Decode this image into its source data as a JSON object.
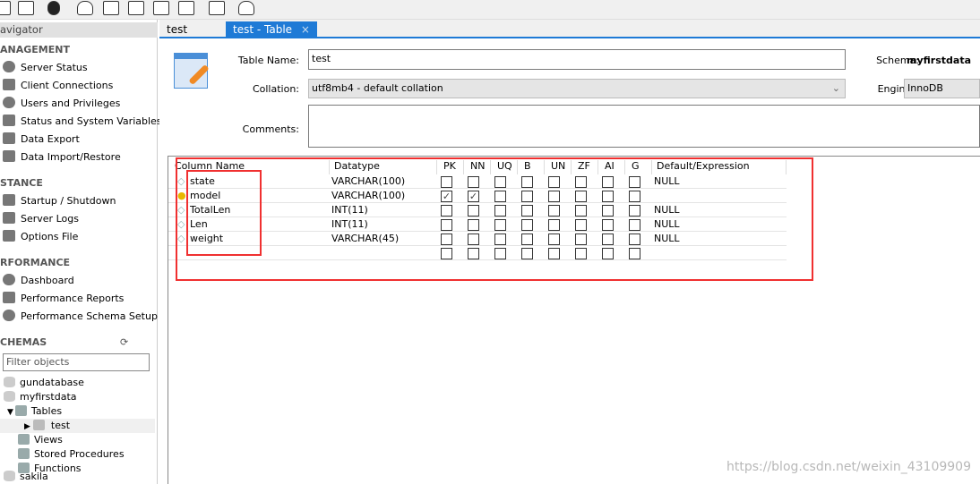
{
  "toolbar": {
    "icons": [
      "new-connection-icon",
      "open-sql-icon",
      "info-icon",
      "create-schema-icon",
      "create-table-icon",
      "create-view-icon",
      "create-procedure-icon",
      "create-function-icon",
      "search-table-icon",
      "reconnect-icon"
    ]
  },
  "sidebar": {
    "header": "avigator",
    "management": {
      "title": "ANAGEMENT",
      "items": [
        "Server Status",
        "Client Connections",
        "Users and Privileges",
        "Status and System Variables",
        "Data Export",
        "Data Import/Restore"
      ]
    },
    "instance": {
      "title": "STANCE",
      "items": [
        "Startup / Shutdown",
        "Server Logs",
        "Options File"
      ]
    },
    "performance": {
      "title": "RFORMANCE",
      "items": [
        "Dashboard",
        "Performance Reports",
        "Performance Schema Setup"
      ]
    },
    "schemas": {
      "title": "CHEMAS",
      "filter_placeholder": "Filter objects",
      "tree": [
        "gundatabase",
        "myfirstdata",
        "Tables",
        "test",
        "Views",
        "Stored Procedures",
        "Functions",
        "sakila"
      ]
    }
  },
  "tabs": [
    {
      "label": "test"
    },
    {
      "label": "test - Table",
      "close": "×",
      "active": true
    }
  ],
  "form": {
    "table_name_label": "Table Name:",
    "table_name": "test",
    "schema_label": "Schema:",
    "schema": "myfirstdata",
    "collation_label": "Collation:",
    "collation": "utf8mb4 - default collation",
    "engine_label": "Engine:",
    "engine": "InnoDB",
    "comments_label": "Comments:",
    "comments": ""
  },
  "grid": {
    "headers": [
      "Column Name",
      "Datatype",
      "PK",
      "NN",
      "UQ",
      "B",
      "UN",
      "ZF",
      "AI",
      "G",
      "Default/Expression"
    ],
    "rows": [
      {
        "name": "state",
        "type": "VARCHAR(100)",
        "flags": [
          false,
          false,
          false,
          false,
          false,
          false,
          false,
          false
        ],
        "default": "NULL",
        "key": false
      },
      {
        "name": "model",
        "type": "VARCHAR(100)",
        "flags": [
          true,
          true,
          false,
          false,
          false,
          false,
          false,
          false
        ],
        "default": "",
        "key": true
      },
      {
        "name": "TotalLen",
        "type": "INT(11)",
        "flags": [
          false,
          false,
          false,
          false,
          false,
          false,
          false,
          false
        ],
        "default": "NULL",
        "key": false
      },
      {
        "name": "Len",
        "type": "INT(11)",
        "flags": [
          false,
          false,
          false,
          false,
          false,
          false,
          false,
          false
        ],
        "default": "NULL",
        "key": false
      },
      {
        "name": "weight",
        "type": "VARCHAR(45)",
        "flags": [
          false,
          false,
          false,
          false,
          false,
          false,
          false,
          false
        ],
        "default": "NULL",
        "key": false
      },
      {
        "name": "",
        "type": "",
        "flags": [
          false,
          false,
          false,
          false,
          false,
          false,
          false,
          false
        ],
        "default": "",
        "key": null
      }
    ]
  },
  "watermark": "https://blog.csdn.net/weixin_43109909",
  "colors": {
    "accent": "#1e7ad6",
    "highlight": "#f03030"
  }
}
